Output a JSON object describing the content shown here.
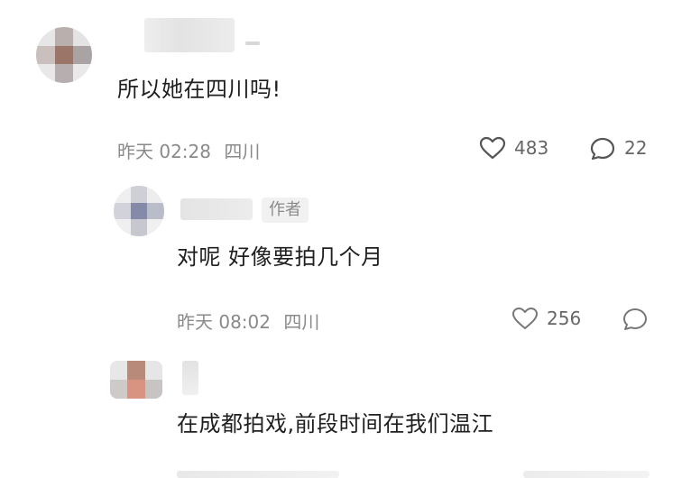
{
  "comments": [
    {
      "text": "所以她在四川吗!",
      "time": "昨天 02:28",
      "location": "四川",
      "likes": "483",
      "replies": "22"
    },
    {
      "author_tag": "作者",
      "text": "对呢 好像要拍几个月",
      "time": "昨天 08:02",
      "location": "四川",
      "likes": "256"
    },
    {
      "text": "在成都拍戏,前段时间在我们温江"
    }
  ],
  "icons": {
    "like": "heart-icon",
    "reply": "speech-bubble-icon"
  },
  "colors": {
    "text": "#1f1f1f",
    "meta": "#8a8a8a",
    "tag_bg": "#f1f1f1"
  }
}
